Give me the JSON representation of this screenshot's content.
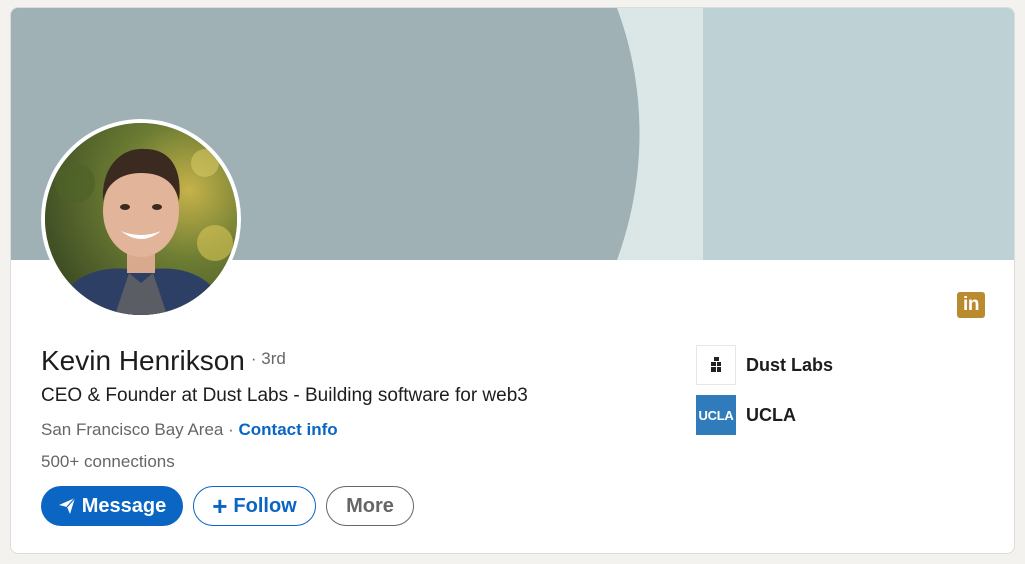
{
  "profile": {
    "name": "Kevin Henrikson",
    "degree": "· 3rd",
    "headline": "CEO & Founder at Dust Labs - Building software for web3",
    "location": "San Francisco Bay Area",
    "location_separator": " · ",
    "contact_info": "Contact info",
    "connections_count": "500+",
    "connections_label": " connections"
  },
  "actions": {
    "message_label": "Message",
    "follow_label": "Follow",
    "more_label": "More"
  },
  "organizations": [
    {
      "name": "Dust Labs",
      "icon": "dust-labs-logo"
    },
    {
      "name": "UCLA",
      "logo_text": "UCLA",
      "icon": "ucla-logo"
    }
  ],
  "brand": {
    "badge_text": "in",
    "badge_color": "#b98a2e",
    "accent": "#0a66c2"
  }
}
